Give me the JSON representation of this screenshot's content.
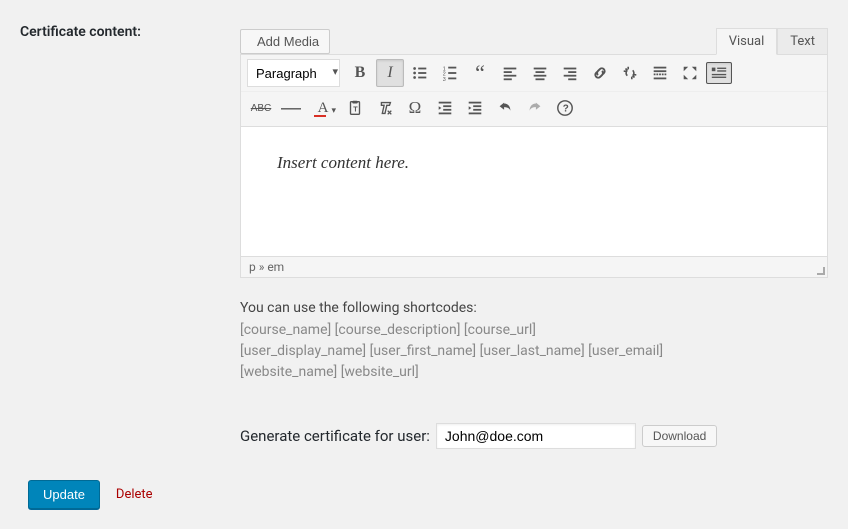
{
  "label": "Certificate content:",
  "add_media_label": "Add Media",
  "tabs": {
    "visual": "Visual",
    "text": "Text"
  },
  "format_select": "Paragraph",
  "toolbar": {
    "bold": "B",
    "italic": "I",
    "abc": "ABC"
  },
  "editor_placeholder": "Insert content here.",
  "status_path": "p » em",
  "hint_title": "You can use the following shortcodes:",
  "shortcode_lines": [
    "[course_name] [course_description] [course_url]",
    "[user_display_name] [user_first_name] [user_last_name] [user_email]",
    "[website_name] [website_url]"
  ],
  "generate_label": "Generate certificate for user:",
  "generate_value": "John@doe.com",
  "download_label": "Download",
  "update_label": "Update",
  "delete_label": "Delete"
}
